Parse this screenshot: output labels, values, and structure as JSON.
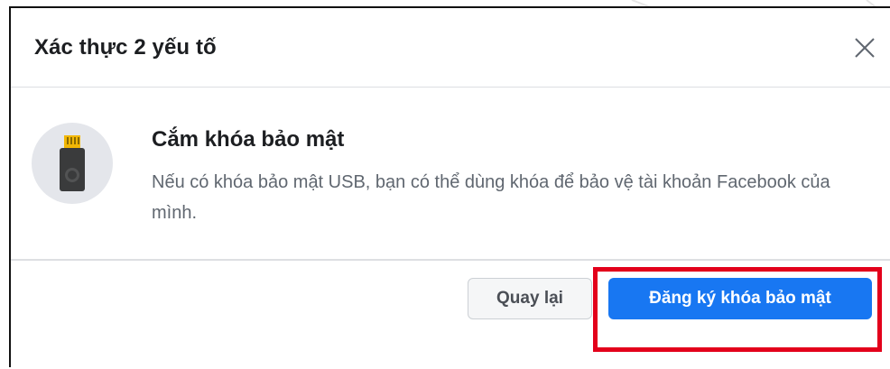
{
  "dialog": {
    "title": "Xác thực 2 yếu tố",
    "close_icon": "close-icon"
  },
  "content": {
    "icon": "usb-key-icon",
    "heading": "Cắm khóa bảo mật",
    "description": "Nếu có khóa bảo mật USB, bạn có thể dùng khóa để bảo vệ tài khoản Facebook của mình."
  },
  "footer": {
    "back_label": "Quay lại",
    "register_label": "Đăng ký khóa bảo mật"
  },
  "colors": {
    "primary": "#1877f2",
    "highlight": "#e3001b",
    "secondary_bg": "#f5f6f7",
    "text_muted": "#606770"
  }
}
